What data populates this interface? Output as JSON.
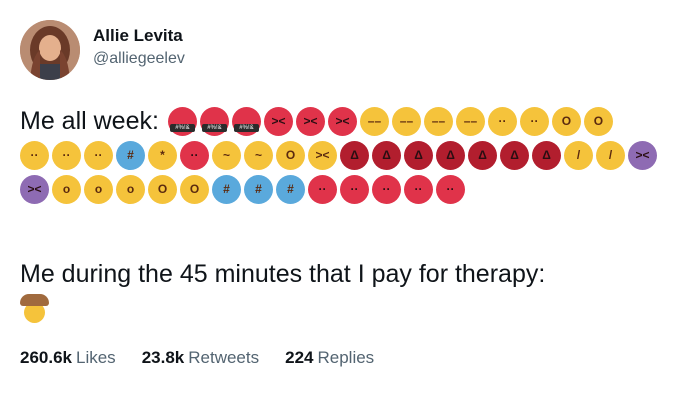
{
  "author": {
    "display_name": "Allie Levita",
    "handle": "@alliegeelev"
  },
  "tweet": {
    "line1_label": "Me all week:",
    "emoji_rows": [
      [
        "enraged-face-cursing",
        "enraged-face-cursing",
        "enraged-face-cursing",
        "angry-red-face",
        "angry-red-face",
        "angry-red-face",
        "downcast-sweat-face",
        "downcast-sweat-face",
        "downcast-sweat-face",
        "downcast-sweat-face",
        "sad-relieved-face",
        "sad-relieved-face",
        "screaming-face",
        "screaming-face"
      ],
      [
        "anxious-sweat-face",
        "anxious-sweat-face",
        "anxious-sweat-face",
        "cold-blue-face",
        "exploding-head",
        "red-cold-face",
        "loudly-crying-face",
        "loudly-crying-face",
        "screaming-face",
        "tired-face",
        "ogre",
        "ogre",
        "ogre",
        "ogre",
        "ogre",
        "ogre",
        "ogre",
        "thermometer-face",
        "thermometer-face",
        "purple-devil"
      ],
      [
        "purple-devil",
        "yawning-face",
        "yawning-face",
        "yawning-face",
        "screaming-face",
        "screaming-face",
        "cold-blue-face",
        "cold-blue-face",
        "cold-blue-face",
        "red-cold-face",
        "red-cold-face",
        "red-cold-face",
        "red-cold-face",
        "red-cold-face"
      ]
    ],
    "line2_text": "Me during the 45 minutes that I pay for therapy:",
    "final_emoji": "cowboy-hat-face"
  },
  "stats": {
    "likes_count": "260.6k",
    "likes_label": "Likes",
    "retweets_count": "23.8k",
    "retweets_label": "Retweets",
    "replies_count": "224",
    "replies_label": "Replies"
  },
  "colors": {
    "text_primary": "#0f1419",
    "text_secondary": "#536471",
    "angry_red": "#e0334a",
    "emoji_yellow": "#f5c33b",
    "devil_purple": "#8e6bb3",
    "cold_blue": "#5aa9dc"
  }
}
